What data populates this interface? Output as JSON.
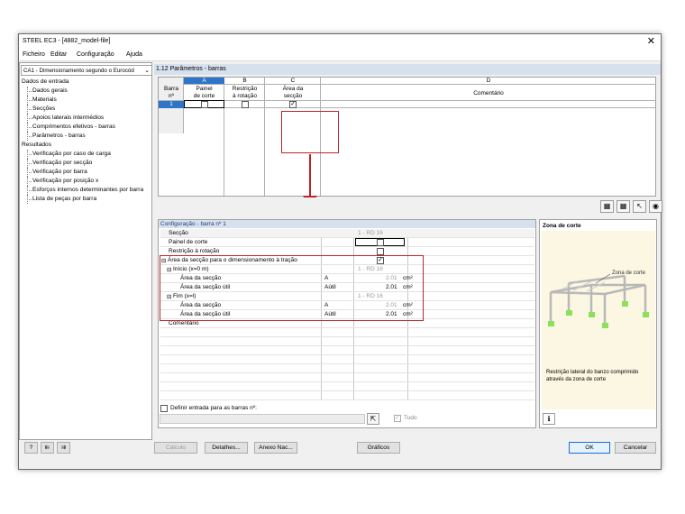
{
  "window": {
    "title": "STEEL EC3 - [4882_model-file]",
    "close": "✕"
  },
  "menu": [
    "Ficheiro",
    "Editar",
    "Configuração",
    "Ajuda"
  ],
  "case_select": "CA1 - Dimensionamento segundo o Eurocód",
  "nav": {
    "group1": "Dados de entrada",
    "items1": [
      "Dados gerais",
      "Materiais",
      "Secções",
      "Apoios laterais intermédios",
      "Comprimentos efetivos - barras",
      "Parâmetros - barras"
    ],
    "group2": "Resultados",
    "items2": [
      "Verificação por caso de carga",
      "Verificação por secção",
      "Verificação por barra",
      "Verificação por posição x",
      "Esforços internos determinantes por barra",
      "Lista de peças por barra"
    ]
  },
  "panel_title": "1.12 Parâmetros - barras",
  "grid": {
    "col_letters": [
      "A",
      "B",
      "C",
      "D"
    ],
    "h_member": "Barra\nnº",
    "h_a": "Painel\nde corte",
    "h_b": "Restrição\nà rotação",
    "h_c": "Área da\nsecção",
    "h_d": "Comentário",
    "row1": "1"
  },
  "config": {
    "title": "Configuração - barra nº 1",
    "r_seccao": "Secção",
    "r_seccao_val": "1 - RD 16",
    "r_painel": "Painel de corte",
    "r_restr": "Restrição à rotação",
    "r_area": "Área da secção para o dimensionamento à tração",
    "r_inicio": "Início (x=0 m)",
    "r_inicio_val": "1 - RD 16",
    "r_area_sec": "Área da secção",
    "sym_a": "A",
    "v1": "2.01",
    "v2": "2.01",
    "unit": "cm²",
    "r_area_util": "Área da secção útil",
    "sym_au": "Aútil",
    "r_fim": "Fim (x=l)",
    "r_fim_val": "1 - RD 16",
    "v3": "2.01",
    "v4": "2.01",
    "r_coment": "Comentário"
  },
  "define_label": "Definir entrada para as barras nº:",
  "tudo": "Tudo",
  "side": {
    "title": "Zona de corte",
    "label": "Zona de corte",
    "caption": "Restrição lateral do banzo comprimido através da zona de corte"
  },
  "buttons": {
    "calc": "Cálculo",
    "details": "Detalhes...",
    "annex": "Anexo Nac...",
    "graphics": "Gráficos",
    "ok": "OK",
    "cancel": "Cancelar"
  }
}
